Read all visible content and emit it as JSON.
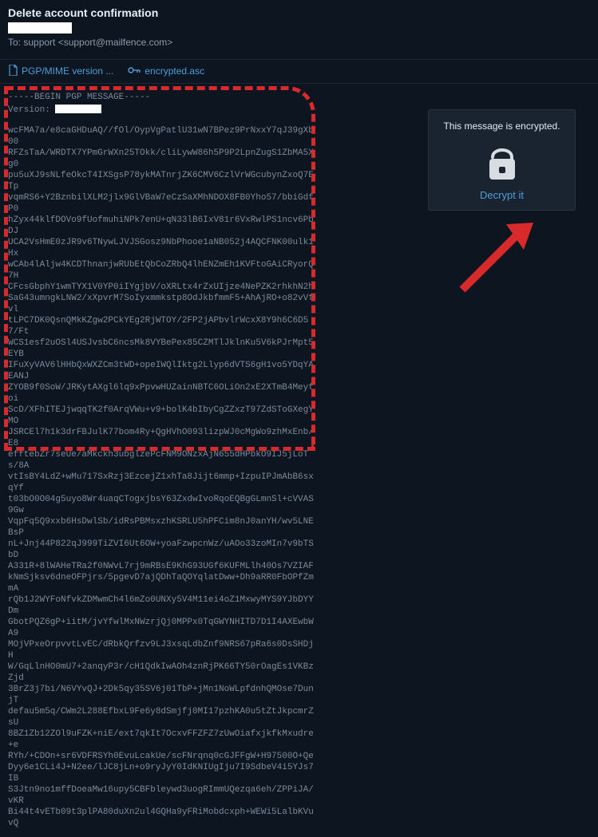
{
  "header": {
    "subject": "Delete account confirmation",
    "to_prefix": "To: ",
    "to_address": "support <support@mailfence.com>"
  },
  "attachments": {
    "pgp_mime": "PGP/MIME version ...",
    "encrypted": "encrypted.asc"
  },
  "pgp": {
    "begin": "-----BEGIN PGP MESSAGE-----",
    "version_label": "Version: ",
    "body": "wcFMA7a/e8caGHDuAQ//fOl/OypVgPatlU31wN7BPez9PrNxxY7qJ39gXb00\nRFZsTaA/WRDTX7YPmGrWXn25TOkk/cliLywW86h5P9P2LpnZugS1ZbMA5Xg0\npu5uXJ9sNLfeOkcT4IXSgsP78ykMATnrjZK6CMV6CzlVrWGcubynZxoQ7ETp\nvqmRS6+Y2BznbilXLM2jlx9GlVBaW7eCzSaXMhNDOX8FB0Yho57/bbiGdfP0\nhZyx44klfDOVo9fUofmuhiNPk7enU+qN33lB6IxV81r6VxRwlPS1ncv6PbDJ\nUCA2VsHmE0zJR9v6TNywLJVJSGosz9NbPhooe1aNB052j4AQCFNK00ulk1Hx\nwCAb4lAljw4KCDThnanjwRUbEtQbCoZRbQ4lhENZmEh1KVFtoGAiCRyorQ7H\nCFcsGbphY1wmTYX1V0YP0iIYgjbV/oXRLtx4rZxUIjze4NePZK2rhkhN2h\nSaG43umngkLNW2/xXpvrM7SoIyxmmkstp8OdJkbfmmF5+AhAjRO+o82vVfvl\ntLPC7DK0QsnQMkKZgw2PCkYEg2RjWTOY/2FP2jAPbvlrWcxX8Y9h6C6D57/Ft\nWCS1esf2uOSl4USJvsbC6ncsMk8VYBePex85CZMTlJklnKu5V6kPJrMpt5EYB\nIFuXyVAV6lHHbQxWXZCm3tWD+opeIWQlIktg2Llyp6dVTS6gH1vo5YDqYAEANJ\nZYOB9f0SoW/JRKytAXgl6lq9xPpvwHUZainNBTC6OLiOn2xE2XTmB4Meyfoi\nScD/XFhITEJjwqqTK2f0ArqVWu+v9+bolK4bIbyCgZZxzT97ZdSToGXegYMO\nJSRCEl7h1k3drFBJulK77bom4Ry+QgHVhO093lizpWJ0cMgWo9zhMxEnb/E8\nefftebZr7seUe/aMkckh3ubglzePcFNM9ONzxAjN655dHPbkO9IJ5jLoTs/8A\nvtIsBY4LdZ+wMu717SxRzj3EzcejZ1xhTa8Jijt6mmp+IzpuIPJmAbB6sxqYf\nt03bO0O04g5uyo8Wr4uaqCTogxjbsY63ZxdwIvoRqoEQBgGLmnSl+cVVAS9Gw\nVqpFq5Q9xxb6HsDwlSb/idRsPBMsxzhKSRLU5hPFCim8nJ0anYH/wv5LNEBsP\nnL+Jnj44P822qJ999TiZVI6Ut6OW+yoaFzwpcnWz/uAOo33zoMIn7v9bTSbD\nA331R+8lWAHeTRa2f0NWvL7rj9mRBsE9KhG93UGf6KUFMLlh40Os7VZIAF\nkNmSjksv6dneOFPjrs/5pgevD7ajQDhTaQOYqlatDww+Dh9aRR0FbOPfZmmA\nrQb1J2WYFoNfvkZDMwmCh4l6mZo0UNXy5V4M11ei4oZ1MxwyMYS9YJbDYYDm\nGbotPQZ6gP+iitM/jvYfwlMxNWzrjQj0MPPx0TqGWYNHITD7D1I4AXEwbWA9\nMOjVPxeOrpvvtLvEC/dRbkQrfzv9LJ3xsqLdbZnf9NRS67pRa6s0DsSHDjH\nW/GqLlnHO0mU7+2anqyP3r/cH1QdkIwAOh4znRjPK66TY50rOagEs1VKBzZjd\n3BrZ3j7bi/N6VYvQJ+2Dk5qy35SV6j01TbP+jMn1NoWLpfdnhQMOse7DunjT\ndefau5m5q/CWm2L288EfbxL9Fe6y8dSmjfj0MI17pzhKA0u5tZtJkpcmrZsU\n8BZ1Zb12ZOl9uFZK+niE/ext7qkIt7OcxvFFZFZ7zUwOiafxjkfkMxudre+e\nRYh/+CDOn+sr6VDFRSYh0EvuLcakUe/scFNrqnq0cGJFFgW+H97500O+Qe\nDyy6e1CLi4J+N2ee/lJC8jLn+o9ryJyY0IdKNIUgIju7I9SdbeV4i5YJs7IB\nS3Jtn9no1mffDoeaMw16upy5CBFbleywd3uogRImmUQezqa6eh/ZPPiJA/vKR\nBi44t4vETb09t3plPA80duXn2ul4GQHa9yFRiMobdcxph+WEWi5LalbKVuvQ"
  },
  "encrypt_box": {
    "title": "This message is encrypted.",
    "action": "Decrypt it"
  },
  "icons": {
    "doc": "doc-icon",
    "key": "key-icon",
    "lock": "lock-icon"
  }
}
